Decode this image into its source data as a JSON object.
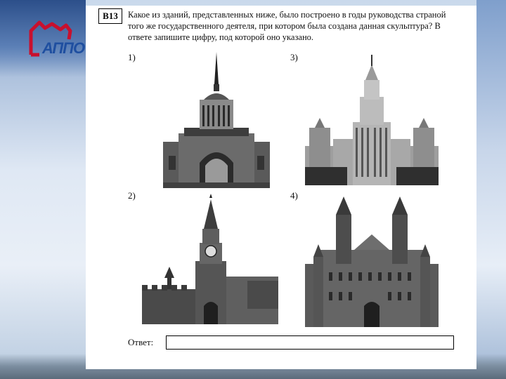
{
  "task": {
    "number": "B13",
    "question": "Какое из зданий, представленных ниже, было построено в годы руководства страной того же государственного деятеля, при котором была создана данная скульптура? В ответе запишите цифру, под которой оно указано."
  },
  "options": [
    {
      "label": "1)",
      "building_icon": "admiralty-building"
    },
    {
      "label": "2)",
      "building_icon": "spasskaya-tower"
    },
    {
      "label": "3)",
      "building_icon": "moscow-university-building"
    },
    {
      "label": "4)",
      "building_icon": "historical-museum-building"
    }
  ],
  "answer": {
    "label": "Ответ:",
    "value": ""
  },
  "logo": {
    "text": "АППО",
    "color": "#c8102e"
  }
}
